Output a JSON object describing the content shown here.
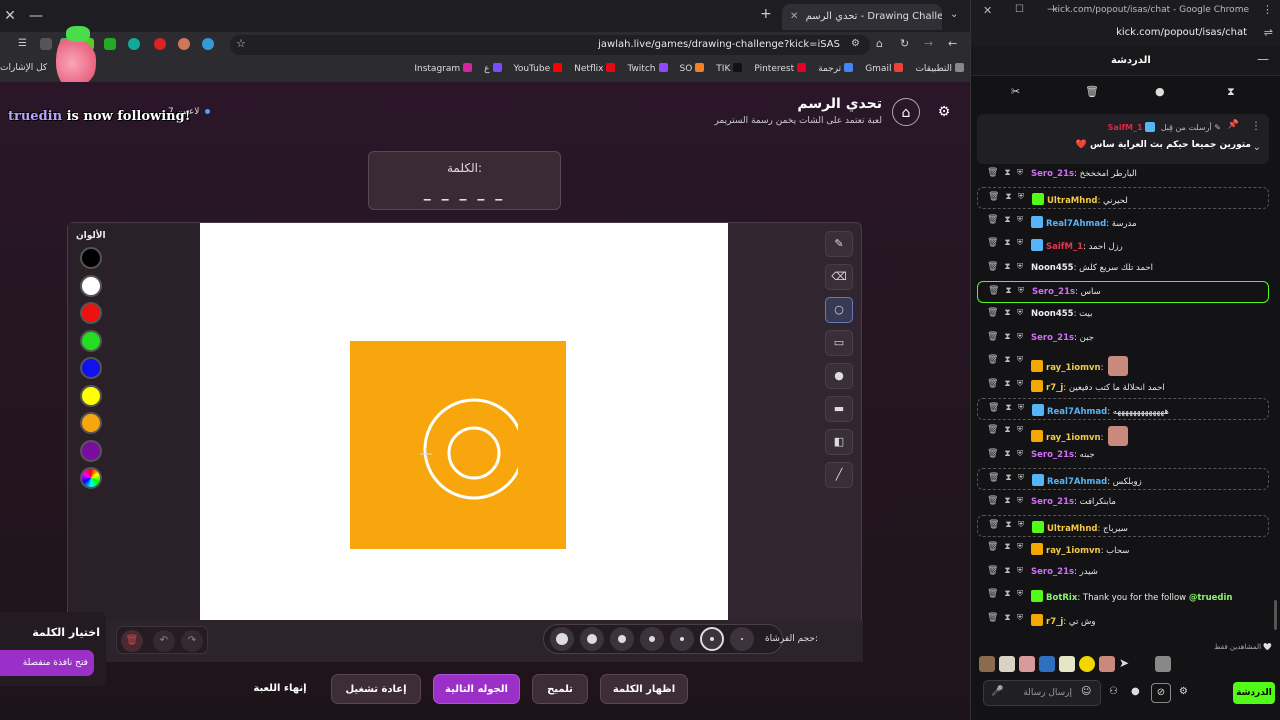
{
  "browser": {
    "tab_title": "تحدي الرسم - Drawing Challenge",
    "url": "jawlah.live/games/drawing-challenge?kick=iSAS",
    "bookmarks": [
      {
        "label": "التطبيقات",
        "color": "#888"
      },
      {
        "label": "Gmail",
        "color": "#ea4335"
      },
      {
        "label": "ترجمة",
        "color": "#4285f4"
      },
      {
        "label": "Pinterest",
        "color": "#e60023"
      },
      {
        "label": "TIK",
        "color": "#111"
      },
      {
        "label": "SO",
        "color": "#f48024"
      },
      {
        "label": "Twitch",
        "color": "#9146ff"
      },
      {
        "label": "Netflix",
        "color": "#e50914"
      },
      {
        "label": "YouTube",
        "color": "#ff0000"
      },
      {
        "label": "ع",
        "color": "#7b4cff"
      },
      {
        "label": "Instagram",
        "color": "#d6249f"
      }
    ],
    "all_bookmarks": "كل الإشارات"
  },
  "game": {
    "title": "تحدي الرسم",
    "subtitle": "لعبة تعتمد على الشات يخمن رسمة الستريمر",
    "players": "7 لاعبين",
    "follow_user": "truedin",
    "follow_text": "is now following!",
    "word_label": "الكلمة:",
    "word_blanks": "_ _ _ _ _",
    "colors_label": "الألوان",
    "colors": [
      "#000000",
      "#ffffff",
      "#ee1111",
      "#22dd22",
      "#1111ee",
      "#ffff00",
      "#f7a70d",
      "#7b0d9e",
      "multi"
    ],
    "brush_label": "حجم الفرشاة:",
    "buttons": {
      "end_game": "إنهاء اللعبة",
      "restart": "إعادة تشغيل",
      "next_round": "الجوله التالية",
      "hint": "تلميح",
      "reveal_word": "اظهار الكلمة"
    },
    "choose_title": "اختيار الكلمة",
    "popout_label": "فتح نافذة منفصلة"
  },
  "chat": {
    "window_title": "kick.com/popout/isas/chat - Google Chrome",
    "url": "kick.com/popout/isas/chat",
    "header_title": "الدردشة",
    "pinned": {
      "sender": "SaifM_1",
      "sent_by_label": "أرسلت من قِبل",
      "message": "❤️ متورين جميعا حيكم بث العراية ساس"
    },
    "messages": [
      {
        "user": "Sero_21s",
        "cls": "u-pink",
        "badge": "",
        "text": "البارطر امخخخخ",
        "style": ""
      },
      {
        "user": "UltraMhnd",
        "cls": "u-yellow",
        "badge": "#53fc18",
        "text": "لحيرني",
        "style": "dashed"
      },
      {
        "user": "Real7Ahmad",
        "cls": "u-blue",
        "badge": "#56b4f9",
        "text": "مدرسة",
        "style": ""
      },
      {
        "user": "SaifM_1",
        "cls": "u-red",
        "badge": "#56b4f9",
        "text": "رزل احمد",
        "style": ""
      },
      {
        "user": "Noon455",
        "cls": "u-white",
        "badge": "",
        "text": "احمد تلك سريع كلش",
        "style": ""
      },
      {
        "user": "Sero_21s",
        "cls": "u-pink",
        "badge": "",
        "text": "ساس",
        "style": "hl"
      },
      {
        "user": "Noon455",
        "cls": "u-white",
        "badge": "",
        "text": "بيت",
        "style": ""
      },
      {
        "user": "Sero_21s",
        "cls": "u-pink",
        "badge": "",
        "text": "جبن",
        "style": ""
      },
      {
        "user": "ray_1iomvn",
        "cls": "u-yellow",
        "badge": "#f2a800",
        "text": "",
        "style": "",
        "avatar": true
      },
      {
        "user": "r7_j",
        "cls": "u-yellow",
        "badge": "#f2a800",
        "text": "احمد انحلالة ما كتب دفيعين",
        "style": ""
      },
      {
        "user": "Real7Ahmad",
        "cls": "u-blue",
        "badge": "#56b4f9",
        "text": "هههههههههههههه",
        "style": "dashed"
      },
      {
        "user": "ray_1iomvn",
        "cls": "u-yellow",
        "badge": "#f2a800",
        "text": "",
        "style": "",
        "avatar": true
      },
      {
        "user": "Sero_21s",
        "cls": "u-pink",
        "badge": "",
        "text": "جبنه",
        "style": ""
      },
      {
        "user": "Real7Ahmad",
        "cls": "u-blue",
        "badge": "#56b4f9",
        "text": "زوبلكس",
        "style": "dashed"
      },
      {
        "user": "Sero_21s",
        "cls": "u-pink",
        "badge": "",
        "text": "مابنكرافت",
        "style": ""
      },
      {
        "user": "UltraMhnd",
        "cls": "u-yellow",
        "badge": "#53fc18",
        "text": "سيرباج",
        "style": "dashed"
      },
      {
        "user": "ray_1iomvn",
        "cls": "u-yellow",
        "badge": "#f2a800",
        "text": "سحاب",
        "style": ""
      },
      {
        "user": "Sero_21s",
        "cls": "u-pink",
        "badge": "",
        "text": "شيدر",
        "style": ""
      },
      {
        "user": "BotRix",
        "cls": "u-green",
        "badge": "#53fc18",
        "text": "Thank you for the follow",
        "mention": "@truedin",
        "style": ""
      },
      {
        "user": "r7_j",
        "cls": "u-yellow",
        "badge": "#f2a800",
        "text": "وش تي",
        "style": ""
      }
    ],
    "viewers_label": "المشاهدين فقط",
    "input_placeholder": "إرسال رسالة",
    "send_label": "الدردشة"
  }
}
